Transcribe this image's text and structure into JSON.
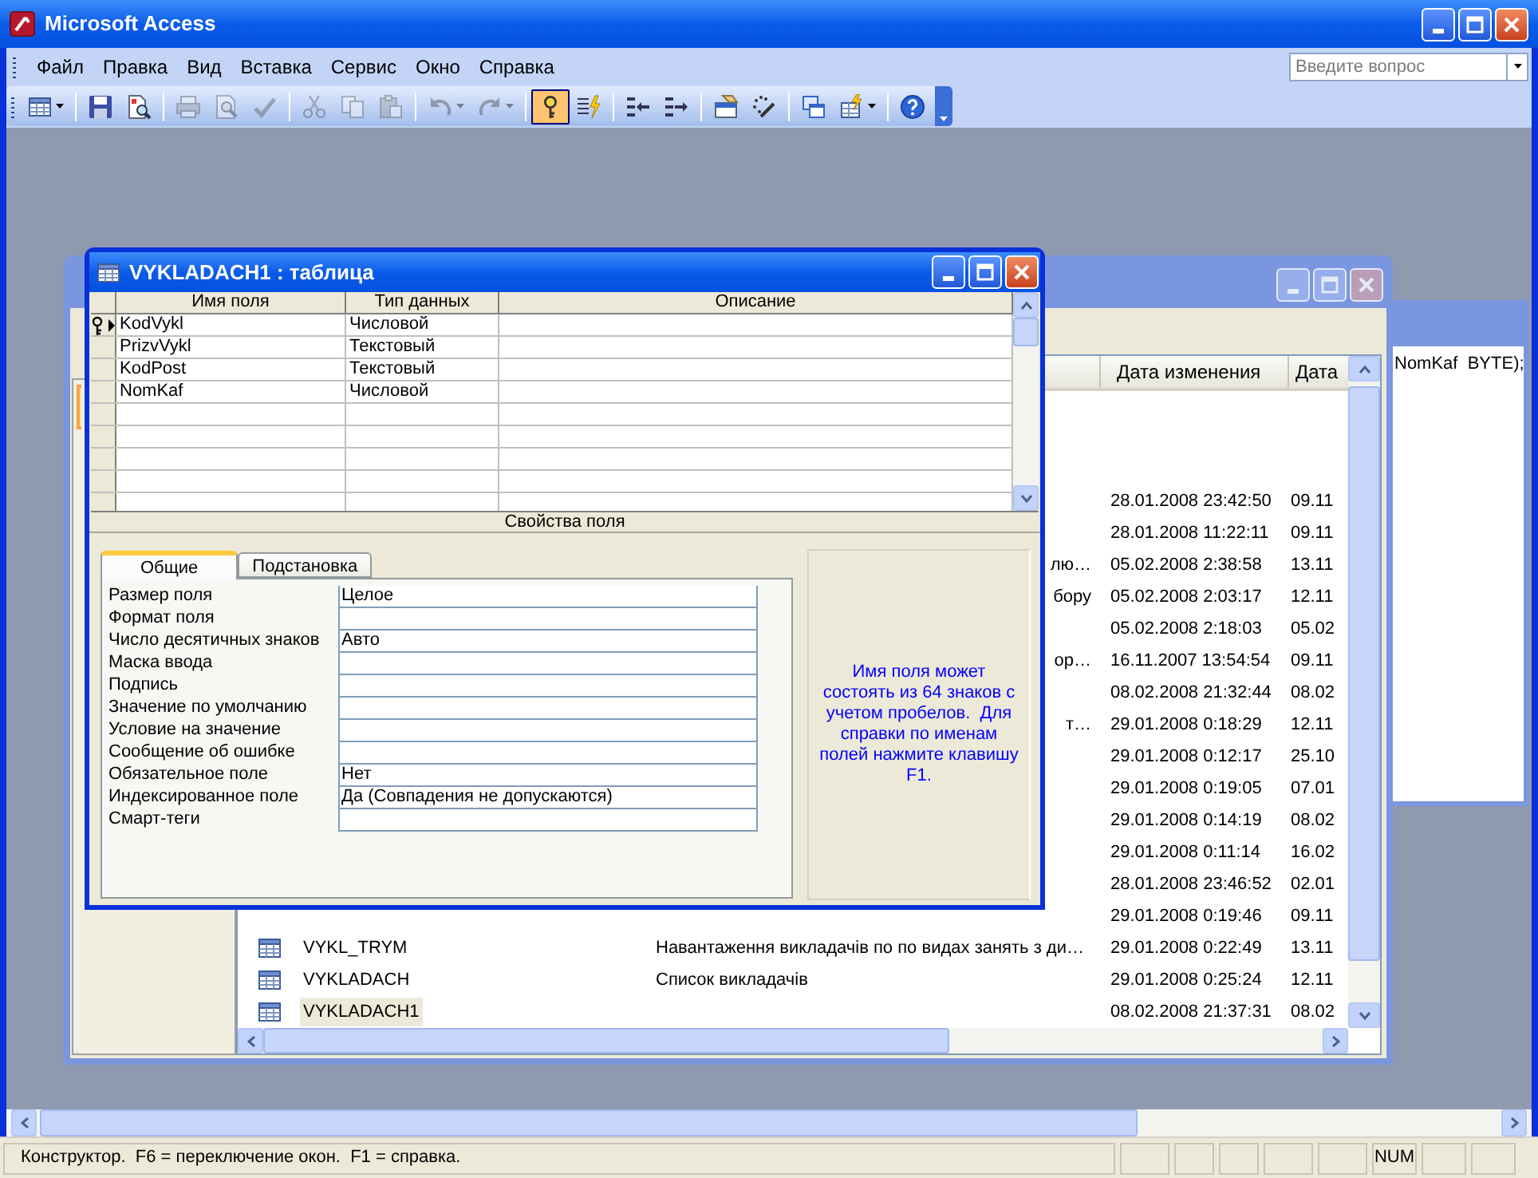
{
  "window": {
    "title": "Microsoft Access"
  },
  "menu": [
    "Файл",
    "Правка",
    "Вид",
    "Вставка",
    "Сервис",
    "Окно",
    "Справка"
  ],
  "help_box": {
    "placeholder": "Введите вопрос"
  },
  "toolbar": [
    {
      "kind": "view",
      "dropdown": true,
      "disabled": false,
      "pressed": false
    },
    {
      "kind": "separator"
    },
    {
      "kind": "save",
      "dropdown": false,
      "disabled": false,
      "pressed": false
    },
    {
      "kind": "file_search",
      "dropdown": false,
      "disabled": false,
      "pressed": false
    },
    {
      "kind": "separator"
    },
    {
      "kind": "print",
      "dropdown": false,
      "disabled": true,
      "pressed": false
    },
    {
      "kind": "preview",
      "dropdown": false,
      "disabled": true,
      "pressed": false
    },
    {
      "kind": "spelling",
      "dropdown": false,
      "disabled": true,
      "pressed": false
    },
    {
      "kind": "separator"
    },
    {
      "kind": "cut",
      "dropdown": false,
      "disabled": true,
      "pressed": false
    },
    {
      "kind": "copy",
      "dropdown": false,
      "disabled": true,
      "pressed": false
    },
    {
      "kind": "paste",
      "dropdown": false,
      "disabled": true,
      "pressed": false
    },
    {
      "kind": "separator"
    },
    {
      "kind": "undo",
      "dropdown": true,
      "disabled": true,
      "pressed": false
    },
    {
      "kind": "redo",
      "dropdown": true,
      "disabled": true,
      "pressed": false
    },
    {
      "kind": "separator"
    },
    {
      "kind": "primary_key",
      "dropdown": false,
      "disabled": false,
      "pressed": true
    },
    {
      "kind": "indexes",
      "dropdown": false,
      "disabled": false,
      "pressed": false
    },
    {
      "kind": "separator"
    },
    {
      "kind": "insert_rows",
      "dropdown": false,
      "disabled": false,
      "pressed": false
    },
    {
      "kind": "delete_rows",
      "dropdown": false,
      "disabled": false,
      "pressed": false
    },
    {
      "kind": "separator"
    },
    {
      "kind": "properties",
      "dropdown": false,
      "disabled": false,
      "pressed": false
    },
    {
      "kind": "builder",
      "dropdown": false,
      "disabled": false,
      "pressed": false
    },
    {
      "kind": "separator"
    },
    {
      "kind": "database_window",
      "dropdown": false,
      "disabled": false,
      "pressed": false
    },
    {
      "kind": "new_object",
      "dropdown": true,
      "disabled": false,
      "pressed": false
    },
    {
      "kind": "separator"
    },
    {
      "kind": "help",
      "dropdown": false,
      "disabled": false,
      "pressed": false
    }
  ],
  "sql_window": {
    "text": "NomKaf  BYTE);"
  },
  "database_window": {
    "columns": [
      "Дата изменения",
      "Дата"
    ],
    "rows": [
      {
        "kind": "covered",
        "modified": "28.01.2008 23:42:50",
        "created": "09.11"
      },
      {
        "kind": "covered",
        "modified": "28.01.2008 11:22:11",
        "created": "09.11"
      },
      {
        "kind": "covered",
        "description": "лю…",
        "modified": "05.02.2008 2:38:58",
        "created": "13.11"
      },
      {
        "kind": "covered",
        "description": "бору",
        "modified": "05.02.2008 2:03:17",
        "created": "12.11"
      },
      {
        "kind": "covered",
        "modified": "05.02.2008 2:18:03",
        "created": "05.02"
      },
      {
        "kind": "covered",
        "description": "ор…",
        "modified": "16.11.2007 13:54:54",
        "created": "09.11"
      },
      {
        "kind": "covered",
        "modified": "08.02.2008 21:32:44",
        "created": "08.02"
      },
      {
        "kind": "covered",
        "description": "т…",
        "modified": "29.01.2008 0:18:29",
        "created": "12.11"
      },
      {
        "kind": "covered",
        "modified": "29.01.2008 0:12:17",
        "created": "25.10"
      },
      {
        "kind": "covered",
        "modified": "29.01.2008 0:19:05",
        "created": "07.01"
      },
      {
        "kind": "covered",
        "modified": "29.01.2008 0:14:19",
        "created": "08.02"
      },
      {
        "kind": "covered",
        "modified": "29.01.2008 0:11:14",
        "created": "16.02"
      },
      {
        "kind": "covered",
        "modified": "28.01.2008 23:46:52",
        "created": "02.01"
      },
      {
        "kind": "covered",
        "modified": "29.01.2008 0:19:46",
        "created": "09.11"
      },
      {
        "kind": "full",
        "name": "VYKL_TRYM",
        "description": "Навантаження викладачів по по видах занять з ди…",
        "modified": "29.01.2008 0:22:49",
        "created": "13.11",
        "selected": false
      },
      {
        "kind": "full",
        "name": "VYKLADACH",
        "description": "Список викладачів",
        "modified": "29.01.2008 0:25:24",
        "created": "12.11",
        "selected": false
      },
      {
        "kind": "full",
        "name": "VYKLADACH1",
        "modified": "08.02.2008 21:37:31",
        "created": "08.02",
        "selected": true
      }
    ]
  },
  "table_design": {
    "title": "VYKLADACH1 : таблица",
    "columns": [
      "Имя поля",
      "Тип данных",
      "Описание"
    ],
    "fields": [
      {
        "name": "KodVykl",
        "type": "Числовой",
        "primary_key": true,
        "current": true
      },
      {
        "name": "PrizvVykl",
        "type": "Текстовый",
        "primary_key": false,
        "current": false
      },
      {
        "name": "KodPost",
        "type": "Текстовый",
        "primary_key": false,
        "current": false
      },
      {
        "name": "NomKaf",
        "type": "Числовой",
        "primary_key": false,
        "current": false
      }
    ],
    "properties_caption": "Свойства поля",
    "property_tabs": [
      {
        "label": "Общие",
        "selected": true
      },
      {
        "label": "Подстановка",
        "selected": false
      }
    ],
    "properties": [
      {
        "label": "Размер поля",
        "value": "Целое"
      },
      {
        "label": "Формат поля"
      },
      {
        "label": "Число десятичных знаков",
        "value": "Авто"
      },
      {
        "label": "Маска ввода"
      },
      {
        "label": "Подпись"
      },
      {
        "label": "Значение по умолчанию"
      },
      {
        "label": "Условие на значение"
      },
      {
        "label": "Сообщение об ошибке"
      },
      {
        "label": "Обязательное поле",
        "value": "Нет"
      },
      {
        "label": "Индексированное поле",
        "value": "Да (Совпадения не допускаются)"
      },
      {
        "label": "Смарт-теги"
      }
    ],
    "help_text": "Имя поля может состоять из 64 знаков с учетом пробелов.  Для справки по именам полей нажмите клавишу F1."
  },
  "status_bar": {
    "text": "Конструктор.  F6 = переключение окон.  F1 = справка.",
    "num_indicator": "NUM"
  }
}
